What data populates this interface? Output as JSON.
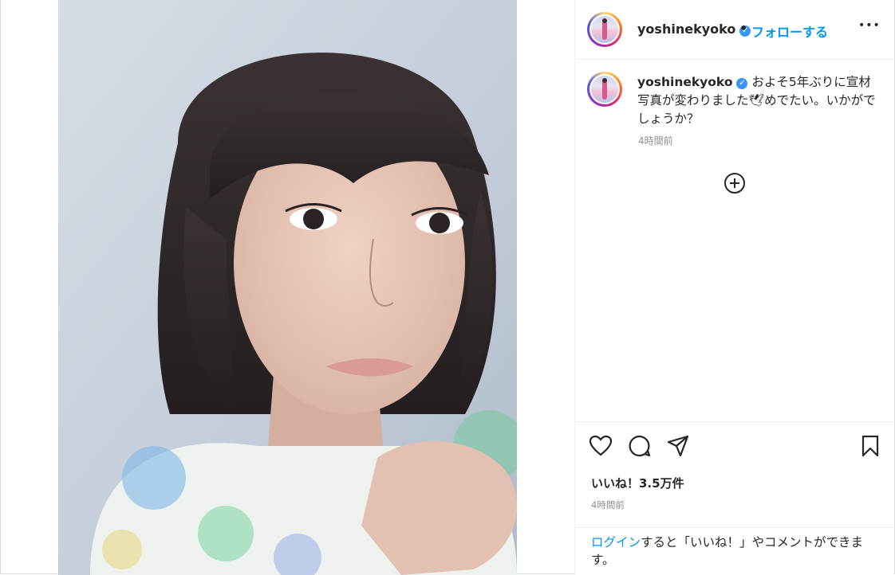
{
  "post": {
    "username": "yoshinekyoko",
    "separator": "•",
    "follow_label": "フォローする",
    "more_label": "•••",
    "verified_glyph": "✓"
  },
  "caption": {
    "username": "yoshinekyoko",
    "text": "およそ5年ぶりに宣材写真が変わりました🕊めでたい。いかがでしょうか？",
    "timestamp": "4時間前"
  },
  "stats": {
    "likes": "いいね！3.5万件",
    "timestamp": "4時間前"
  },
  "login_prompt": {
    "link": "ログイン",
    "text": "すると「いいね！」やコメントができます。"
  },
  "icons": {
    "like": "heart-icon",
    "comment": "comment-icon",
    "share": "paper-plane-icon",
    "save": "bookmark-icon",
    "add": "plus-circle-icon",
    "more": "more-horizontal-icon"
  },
  "colors": {
    "accent": "#0095f6",
    "verified": "#3897f0",
    "text": "#262626",
    "muted": "#8e8e8e"
  }
}
